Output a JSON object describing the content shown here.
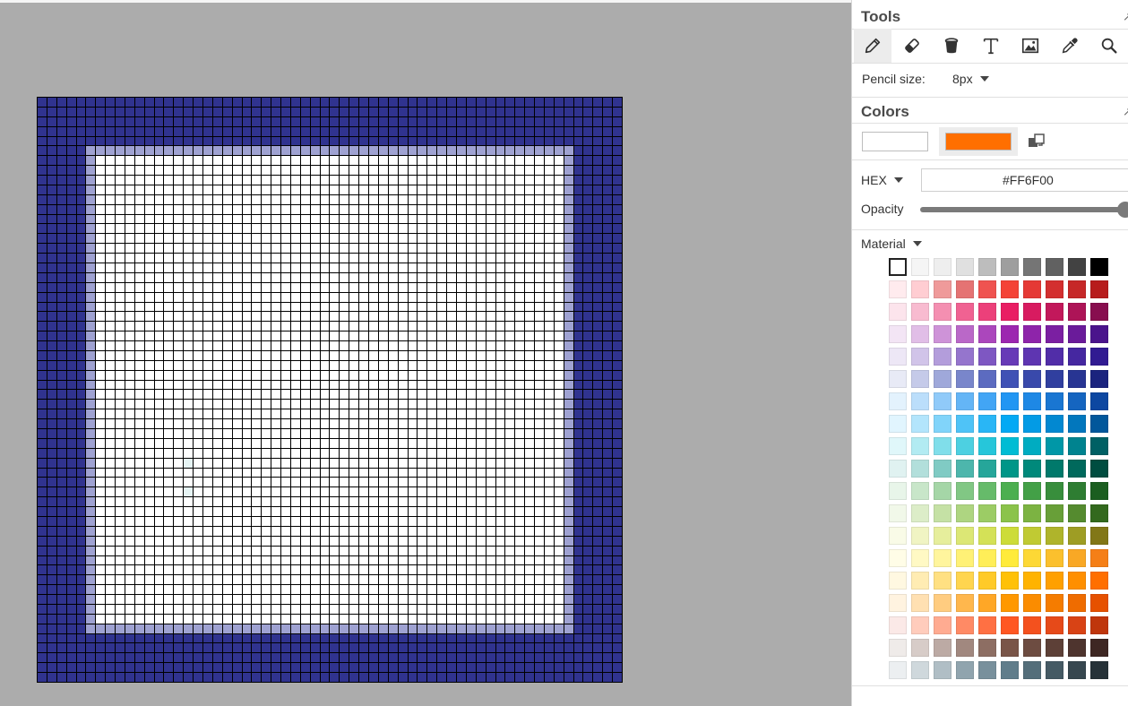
{
  "canvas": {
    "grid_size": 60,
    "colors": {
      "frame_outer": "#30338F",
      "frame_inner": "#9FA2D2",
      "fill": "#FFFFFF",
      "faint": "#E6F4F4"
    }
  },
  "tools": {
    "title": "Tools",
    "items": [
      {
        "name": "pencil",
        "active": true
      },
      {
        "name": "eraser",
        "active": false
      },
      {
        "name": "bucket",
        "active": false
      },
      {
        "name": "text",
        "active": false
      },
      {
        "name": "image",
        "active": false
      },
      {
        "name": "eyedropper",
        "active": false
      },
      {
        "name": "magnifier",
        "active": false
      }
    ],
    "pencil_size_label": "Pencil size:",
    "pencil_size_value": "8px"
  },
  "colors": {
    "title": "Colors",
    "primary": "#FFFFFF",
    "secondary": "#FF6F00",
    "format_label": "HEX",
    "hex_value": "#FF6F00",
    "opacity_label": "Opacity",
    "opacity_value": 1.0,
    "palette_label": "Material",
    "palette": [
      [
        "#FFFFFF",
        "#F5F5F5",
        "#EEEEEE",
        "#E0E0E0",
        "#BDBDBD",
        "#9E9E9E",
        "#757575",
        "#616161",
        "#424242",
        "#000000"
      ],
      [
        "#FFEBEE",
        "#FFCDD2",
        "#EF9A9A",
        "#E57373",
        "#EF5350",
        "#F44336",
        "#E53935",
        "#D32F2F",
        "#C62828",
        "#B71C1C"
      ],
      [
        "#FCE4EC",
        "#F8BBD0",
        "#F48FB1",
        "#F06292",
        "#EC407A",
        "#E91E63",
        "#D81B60",
        "#C2185B",
        "#AD1457",
        "#880E4F"
      ],
      [
        "#F3E5F5",
        "#E1BEE7",
        "#CE93D8",
        "#BA68C8",
        "#AB47BC",
        "#9C27B0",
        "#8E24AA",
        "#7B1FA2",
        "#6A1B9A",
        "#4A148C"
      ],
      [
        "#EDE7F6",
        "#D1C4E9",
        "#B39DDB",
        "#9575CD",
        "#7E57C2",
        "#673AB7",
        "#5E35B1",
        "#512DA8",
        "#4527A0",
        "#311B92"
      ],
      [
        "#E8EAF6",
        "#C5CAE9",
        "#9FA8DA",
        "#7986CB",
        "#5C6BC0",
        "#3F51B5",
        "#3949AB",
        "#303F9F",
        "#283593",
        "#1A237E"
      ],
      [
        "#E3F2FD",
        "#BBDEFB",
        "#90CAF9",
        "#64B5F6",
        "#42A5F5",
        "#2196F3",
        "#1E88E5",
        "#1976D2",
        "#1565C0",
        "#0D47A1"
      ],
      [
        "#E1F5FE",
        "#B3E5FC",
        "#81D4FA",
        "#4FC3F7",
        "#29B6F6",
        "#03A9F4",
        "#039BE5",
        "#0288D1",
        "#0277BD",
        "#01579B"
      ],
      [
        "#E0F7FA",
        "#B2EBF2",
        "#80DEEA",
        "#4DD0E1",
        "#26C6DA",
        "#00BCD4",
        "#00ACC1",
        "#0097A7",
        "#00838F",
        "#006064"
      ],
      [
        "#E0F2F1",
        "#B2DFDB",
        "#80CBC4",
        "#4DB6AC",
        "#26A69A",
        "#009688",
        "#00897B",
        "#00796B",
        "#00695C",
        "#004D40"
      ],
      [
        "#E8F5E9",
        "#C8E6C9",
        "#A5D6A7",
        "#81C784",
        "#66BB6A",
        "#4CAF50",
        "#43A047",
        "#388E3C",
        "#2E7D32",
        "#1B5E20"
      ],
      [
        "#F1F8E9",
        "#DCEDC8",
        "#C5E1A5",
        "#AED581",
        "#9CCC65",
        "#8BC34A",
        "#7CB342",
        "#689F38",
        "#558B2F",
        "#33691E"
      ],
      [
        "#F9FBE7",
        "#F0F4C3",
        "#E6EE9C",
        "#DCE775",
        "#D4E157",
        "#CDDC39",
        "#C0CA33",
        "#AFB42B",
        "#9E9D24",
        "#827717"
      ],
      [
        "#FFFDE7",
        "#FFF9C4",
        "#FFF59D",
        "#FFF176",
        "#FFEE58",
        "#FFEB3B",
        "#FDD835",
        "#FBC02D",
        "#F9A825",
        "#F57F17"
      ],
      [
        "#FFF8E1",
        "#FFECB3",
        "#FFE082",
        "#FFD54F",
        "#FFCA28",
        "#FFC107",
        "#FFB300",
        "#FFA000",
        "#FF8F00",
        "#FF6F00"
      ],
      [
        "#FFF3E0",
        "#FFE0B2",
        "#FFCC80",
        "#FFB74D",
        "#FFA726",
        "#FF9800",
        "#FB8C00",
        "#F57C00",
        "#EF6C00",
        "#E65100"
      ],
      [
        "#FBE9E7",
        "#FFCCBC",
        "#FFAB91",
        "#FF8A65",
        "#FF7043",
        "#FF5722",
        "#F4511E",
        "#E64A19",
        "#D84315",
        "#BF360C"
      ],
      [
        "#EFEBE9",
        "#D7CCC8",
        "#BCAAA4",
        "#A1887F",
        "#8D6E63",
        "#795548",
        "#6D4C41",
        "#5D4037",
        "#4E342E",
        "#3E2723"
      ],
      [
        "#ECEFF1",
        "#CFD8DC",
        "#B0BEC5",
        "#90A4AE",
        "#78909C",
        "#607D8B",
        "#546E7A",
        "#455A64",
        "#37474F",
        "#263238"
      ]
    ]
  }
}
